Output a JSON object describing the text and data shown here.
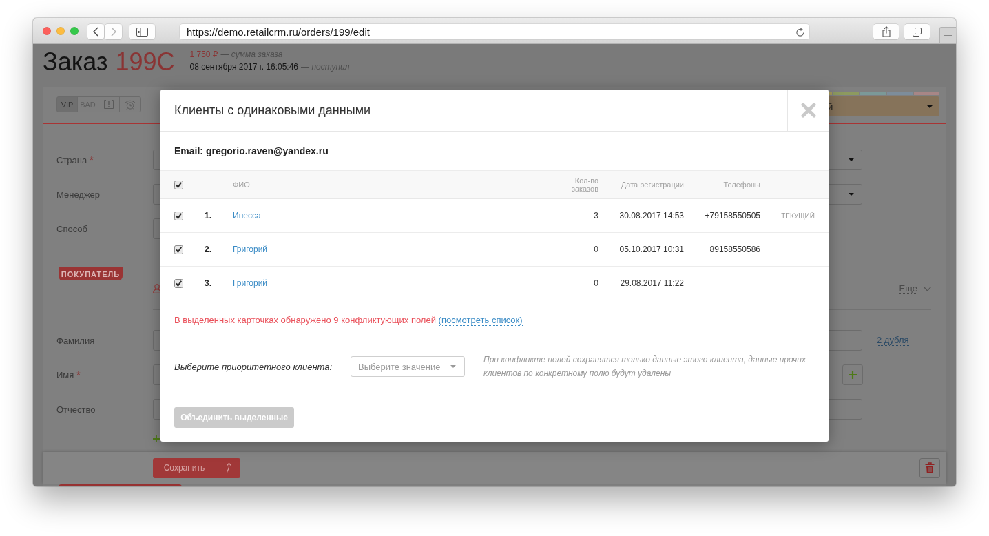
{
  "browser": {
    "url": "https://demo.retailcrm.ru/orders/199/edit"
  },
  "order": {
    "title": "Заказ",
    "number": "199C",
    "sum": "1 750 ₽",
    "sum_caption": "— сумма заказа",
    "received": "08 сентября 2017 г. 16:05:46",
    "received_caption": "— поступил"
  },
  "toolbar": {
    "tags": [
      {
        "kind": "text",
        "label": "VIP",
        "selected": true
      },
      {
        "kind": "text",
        "label": "BAD",
        "selected": false
      },
      {
        "kind": "notice",
        "selected": false
      },
      {
        "kind": "alarm",
        "selected": false
      }
    ],
    "status_colors": [
      {
        "color": "#a59a5b"
      },
      {
        "color": "#8d9a5f"
      },
      {
        "color": "#7b9998"
      },
      {
        "color": "#7d8d9b"
      },
      {
        "color": "#a88686"
      }
    ],
    "status_select": {
      "value": "й"
    }
  },
  "order_fields": [
    {
      "label": "Страна",
      "required_mark": "*",
      "kind": "select"
    },
    {
      "label": "Менеджер",
      "kind": "select"
    },
    {
      "label": "Способ",
      "kind": "short"
    }
  ],
  "customer": {
    "section": "ПОКУПАТЕЛЬ",
    "more": "Еще",
    "fields": [
      {
        "label": "Фамилия",
        "kind": "duplicates",
        "link": "2 дубля"
      },
      {
        "label": "Имя",
        "required_mark": "*",
        "kind": "addable"
      },
      {
        "label": "Отчество",
        "kind": "input"
      }
    ]
  },
  "actions": {
    "save": "Сохранить"
  },
  "modal": {
    "title": "Клиенты с одинаковыми данными",
    "email": "Email: gregorio.raven@yandex.ru",
    "table": {
      "all_checked": true,
      "columns": [
        "ФИО",
        "Кол-во заказов",
        "Дата регистрации",
        "Телефоны"
      ],
      "rows": [
        {
          "checked": true,
          "number": "1.",
          "name": "Инесса",
          "orders": "3",
          "registered": "30.08.2017 14:53",
          "phone": "+79158550505",
          "status": "ТЕКУЩИЙ"
        },
        {
          "checked": true,
          "number": "2.",
          "name": "Григорий",
          "orders": "0",
          "registered": "05.10.2017 10:31",
          "phone": "89158550586"
        },
        {
          "checked": true,
          "number": "3.",
          "name": "Григорий",
          "orders": "0",
          "registered": "29.08.2017 11:22"
        }
      ]
    },
    "conflict": {
      "message": "В выделенных карточках обнаружено 9 конфликтующих полей",
      "link": "(посмотреть список)"
    },
    "priority": {
      "label": "Выберите приоритетного клиента:",
      "placeholder": "Выберите значение",
      "hint": "При конфликте полей сохранятся только данные этого клиента, данные прочих клиентов по конкретному полю будут удалены"
    },
    "merge_button": {
      "label": "Объединить выделенные",
      "disabled": true
    }
  }
}
